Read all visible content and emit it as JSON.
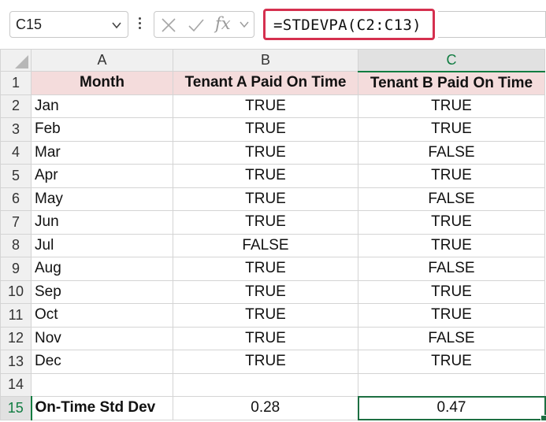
{
  "formula_bar": {
    "name_box": "C15",
    "fx_label": "fx",
    "formula": "=STDEVPA(C2:C13)",
    "icons": [
      "chevron-down-icon",
      "more-options-icon",
      "cancel-icon",
      "enter-icon",
      "function-icon",
      "chevron-down-icon"
    ]
  },
  "columns": [
    "A",
    "B",
    "C"
  ],
  "selected_column": "C",
  "selected_row": "15",
  "rows": [
    {
      "num": "1",
      "a": "Month",
      "b": "Tenant A Paid On Time",
      "c": "Tenant B Paid On Time"
    },
    {
      "num": "2",
      "a": "Jan",
      "b": "TRUE",
      "c": "TRUE"
    },
    {
      "num": "3",
      "a": "Feb",
      "b": "TRUE",
      "c": "TRUE"
    },
    {
      "num": "4",
      "a": "Mar",
      "b": "TRUE",
      "c": "FALSE"
    },
    {
      "num": "5",
      "a": "Apr",
      "b": "TRUE",
      "c": "TRUE"
    },
    {
      "num": "6",
      "a": "May",
      "b": "TRUE",
      "c": "FALSE"
    },
    {
      "num": "7",
      "a": "Jun",
      "b": "TRUE",
      "c": "TRUE"
    },
    {
      "num": "8",
      "a": "Jul",
      "b": "FALSE",
      "c": "TRUE"
    },
    {
      "num": "9",
      "a": "Aug",
      "b": "TRUE",
      "c": "FALSE"
    },
    {
      "num": "10",
      "a": "Sep",
      "b": "TRUE",
      "c": "TRUE"
    },
    {
      "num": "11",
      "a": "Oct",
      "b": "TRUE",
      "c": "TRUE"
    },
    {
      "num": "12",
      "a": "Nov",
      "b": "TRUE",
      "c": "FALSE"
    },
    {
      "num": "13",
      "a": "Dec",
      "b": "TRUE",
      "c": "TRUE"
    },
    {
      "num": "14",
      "a": "",
      "b": "",
      "c": ""
    },
    {
      "num": "15",
      "a": "On-Time Std Dev",
      "b": "0.28",
      "c": "0.47"
    }
  ],
  "colors": {
    "header_fill": "#f4dcdc",
    "formula_highlight": "#d5304f",
    "selection": "#107c41"
  }
}
